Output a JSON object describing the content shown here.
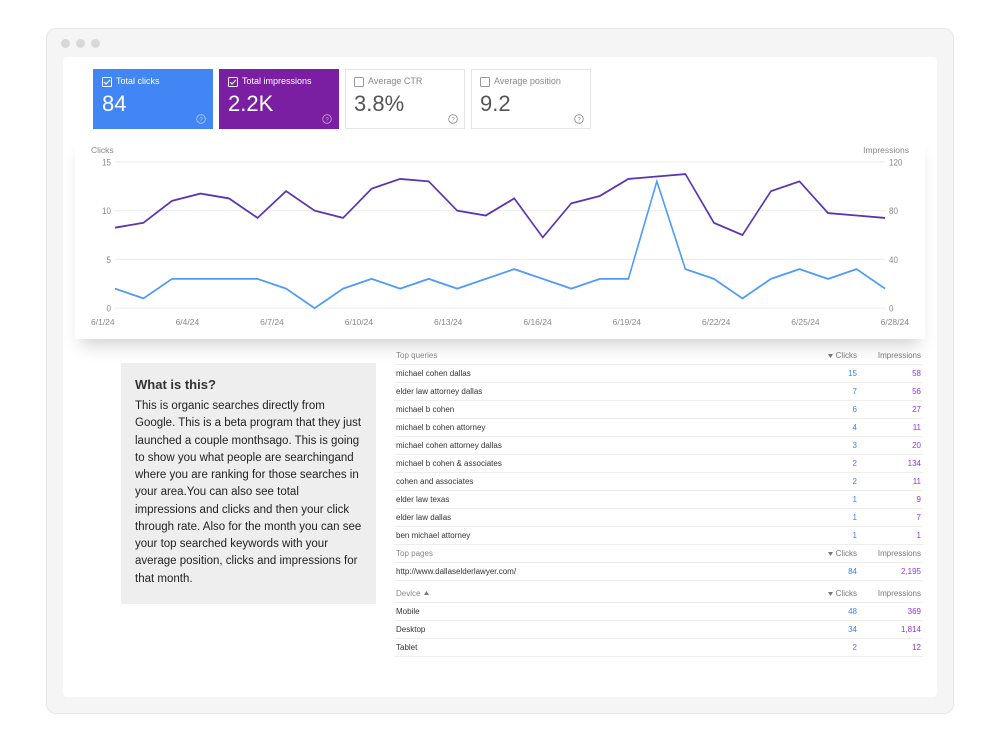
{
  "metrics": [
    {
      "label": "Total clicks",
      "value": "84",
      "state": "active-blue",
      "checked": true
    },
    {
      "label": "Total impressions",
      "value": "2.2K",
      "state": "active-purple",
      "checked": true
    },
    {
      "label": "Average CTR",
      "value": "3.8%",
      "state": "inactive",
      "checked": false
    },
    {
      "label": "Average position",
      "value": "9.2",
      "state": "inactive",
      "checked": false
    }
  ],
  "sidebar": {
    "heading": "What is this?",
    "body": "This is organic searches directly from Google. This is a beta program that they just launched a couple monthsago. This is going to show you what people are searchingand where you are ranking for those searches in your area.You can also see total impressions and clicks and then your click through rate. Also for the month you can see your top searched keywords with your average position, clicks and impressions for that month."
  },
  "chart_data": {
    "type": "line",
    "left_label": "Clicks",
    "right_label": "Impressions",
    "ylim_left": [
      0,
      15
    ],
    "ylim_right": [
      0,
      120
    ],
    "y_ticks_left": [
      0,
      5,
      10,
      15
    ],
    "y_ticks_right": [
      0,
      40,
      80,
      120
    ],
    "x_labels": [
      "6/1/24",
      "6/4/24",
      "6/7/24",
      "6/10/24",
      "6/13/24",
      "6/16/24",
      "6/19/24",
      "6/22/24",
      "6/25/24",
      "6/28/24"
    ],
    "x_count": 28,
    "series": [
      {
        "name": "Clicks",
        "axis": "left",
        "color": "#4F9BF8",
        "values": [
          2,
          1,
          3,
          3,
          3,
          3,
          2,
          0,
          2,
          3,
          2,
          3,
          2,
          3,
          4,
          3,
          2,
          3,
          3,
          13,
          4,
          3,
          1,
          3,
          4,
          3,
          4,
          2
        ]
      },
      {
        "name": "Impressions",
        "axis": "right",
        "color": "#5C34B2",
        "values": [
          66,
          70,
          88,
          94,
          90,
          74,
          96,
          80,
          74,
          98,
          106,
          104,
          80,
          76,
          90,
          58,
          86,
          92,
          106,
          108,
          110,
          70,
          60,
          96,
          104,
          78,
          76,
          74
        ]
      }
    ]
  },
  "tables": {
    "queries": {
      "header": "Top queries",
      "col_clicks": "Clicks",
      "col_impr": "Impressions",
      "rows": [
        {
          "label": "michael cohen dallas",
          "clicks": "15",
          "impr": "58"
        },
        {
          "label": "elder law attorney dallas",
          "clicks": "7",
          "impr": "56"
        },
        {
          "label": "michael b cohen",
          "clicks": "6",
          "impr": "27"
        },
        {
          "label": "michael b cohen attorney",
          "clicks": "4",
          "impr": "11"
        },
        {
          "label": "michael cohen attorney dallas",
          "clicks": "3",
          "impr": "20"
        },
        {
          "label": "michael b cohen & associates",
          "clicks": "2",
          "impr": "134"
        },
        {
          "label": "cohen and associates",
          "clicks": "2",
          "impr": "11"
        },
        {
          "label": "elder law texas",
          "clicks": "1",
          "impr": "9"
        },
        {
          "label": "elder law dallas",
          "clicks": "1",
          "impr": "7"
        },
        {
          "label": "ben michael attorney",
          "clicks": "1",
          "impr": "1"
        }
      ]
    },
    "pages": {
      "header": "Top pages",
      "col_clicks": "Clicks",
      "col_impr": "Impressions",
      "rows": [
        {
          "label": "http://www.dallaselderlawyer.com/",
          "clicks": "84",
          "impr": "2,195"
        }
      ]
    },
    "devices": {
      "header": "Device",
      "col_clicks": "Clicks",
      "col_impr": "Impressions",
      "rows": [
        {
          "label": "Mobile",
          "clicks": "48",
          "impr": "369"
        },
        {
          "label": "Desktop",
          "clicks": "34",
          "impr": "1,814"
        },
        {
          "label": "Tablet",
          "clicks": "2",
          "impr": "12"
        }
      ]
    }
  }
}
